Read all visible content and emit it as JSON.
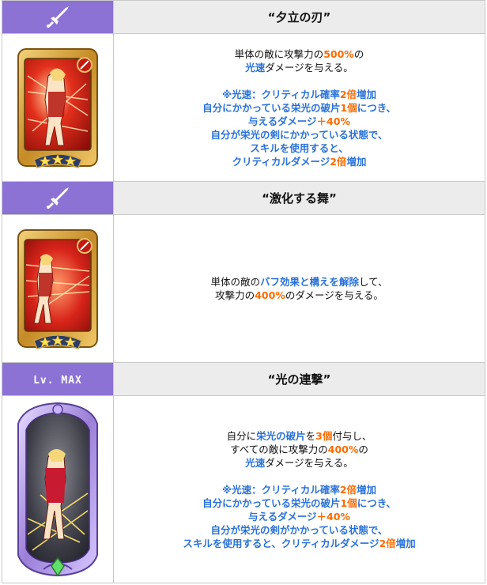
{
  "skills": [
    {
      "header_left": "",
      "header_left_icon": "sword-icon",
      "name": "“夕立の刃”",
      "stars": 3,
      "desc_lines": [
        [
          {
            "t": "単体の敵に攻撃力の",
            "c": "n"
          },
          {
            "t": "500%",
            "c": "o"
          },
          {
            "t": "の",
            "c": "n"
          }
        ],
        [
          {
            "t": "光速",
            "c": "b"
          },
          {
            "t": "ダメージを与える。",
            "c": "n"
          }
        ],
        [],
        [
          {
            "t": "※光速：クリティカル確率",
            "c": "b"
          },
          {
            "t": "2倍",
            "c": "o"
          },
          {
            "t": "増加",
            "c": "b"
          }
        ],
        [
          {
            "t": "自分にかかっている栄光の破片",
            "c": "b"
          },
          {
            "t": "1個",
            "c": "o"
          },
          {
            "t": "につき、",
            "c": "b"
          }
        ],
        [
          {
            "t": "与えるダメージ",
            "c": "b"
          },
          {
            "t": "＋40%",
            "c": "o"
          }
        ],
        [
          {
            "t": "自分が栄光の剣にかかっている状態で、",
            "c": "b"
          }
        ],
        [
          {
            "t": "スキルを使用すると、",
            "c": "b"
          }
        ],
        [
          {
            "t": "クリティカルダメージ",
            "c": "b"
          },
          {
            "t": "2倍",
            "c": "o"
          },
          {
            "t": "増加",
            "c": "b"
          }
        ]
      ]
    },
    {
      "header_left": "",
      "header_left_icon": "sword-icon",
      "name": "“激化する舞”",
      "stars": 3,
      "desc_lines": [
        [
          {
            "t": "単体の敵の",
            "c": "n"
          },
          {
            "t": "バフ効果と構えを解除",
            "c": "b"
          },
          {
            "t": "して、",
            "c": "n"
          }
        ],
        [
          {
            "t": "攻撃力の",
            "c": "n"
          },
          {
            "t": "400%",
            "c": "o"
          },
          {
            "t": "のダメージを与える。",
            "c": "n"
          }
        ]
      ]
    },
    {
      "header_left": "Lv. MAX",
      "header_left_icon": "",
      "name": "“光の連撃”",
      "stars": 0,
      "desc_lines": [
        [
          {
            "t": "自分に",
            "c": "n"
          },
          {
            "t": "栄光の破片",
            "c": "b"
          },
          {
            "t": "を",
            "c": "n"
          },
          {
            "t": "3個",
            "c": "o"
          },
          {
            "t": "付与し、",
            "c": "n"
          }
        ],
        [
          {
            "t": "すべての敵に攻撃力の",
            "c": "n"
          },
          {
            "t": "400%",
            "c": "o"
          },
          {
            "t": "の",
            "c": "n"
          }
        ],
        [
          {
            "t": "光速",
            "c": "b"
          },
          {
            "t": "ダメージを与える。",
            "c": "n"
          }
        ],
        [],
        [
          {
            "t": "※光速：クリティカル確率",
            "c": "b"
          },
          {
            "t": "2倍",
            "c": "o"
          },
          {
            "t": "増加",
            "c": "b"
          }
        ],
        [
          {
            "t": "自分にかかっている栄光の破片",
            "c": "b"
          },
          {
            "t": "1個",
            "c": "o"
          },
          {
            "t": "につき、",
            "c": "b"
          }
        ],
        [
          {
            "t": "与えるダメージ",
            "c": "b"
          },
          {
            "t": "＋40%",
            "c": "o"
          }
        ],
        [
          {
            "t": "自分が栄光の剣がかかっている状態で、",
            "c": "b"
          }
        ],
        [
          {
            "t": "スキルを使用すると、クリティカルダメージ",
            "c": "b"
          },
          {
            "t": "2倍",
            "c": "o"
          },
          {
            "t": "増加",
            "c": "b"
          }
        ]
      ]
    }
  ],
  "colors": {
    "header_purple": "#8c72d4",
    "header_grey": "#ececec",
    "text_blue": "#2a72d8",
    "text_orange": "#ff6a00",
    "card_red": "#c81a12",
    "card_gold": "#d8a63a",
    "card_silver_purple": "#a98fe0"
  }
}
